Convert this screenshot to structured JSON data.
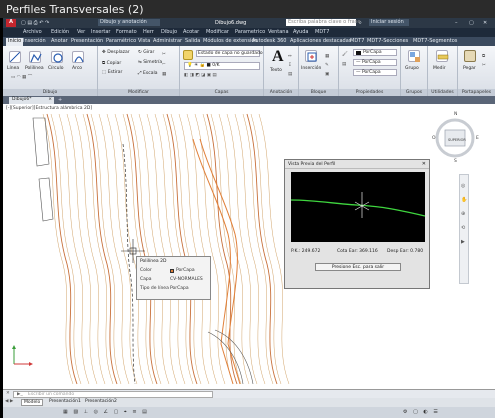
{
  "window": {
    "title": "Perfiles Transversales (2)"
  },
  "qat": {
    "workspace": "Dibujo y anotación",
    "filename": "Dibujo6.dwg",
    "search_placeholder": "Escriba palabra clave o frase",
    "signin": "Iniciar sesión"
  },
  "menubar": {
    "items": [
      "Archivo",
      "Edición",
      "Ver",
      "Insertar",
      "Formato",
      "Herr",
      "Dibujo",
      "Acotar",
      "Modificar",
      "Parametrico",
      "Ventana",
      "Ayuda",
      "MDT7"
    ]
  },
  "ribbon_tabs": {
    "items": [
      "Inicio",
      "Inserción",
      "Anotar",
      "Presentación",
      "Paramétrico",
      "Vista",
      "Administrar",
      "Salida",
      "Módulos de extensión",
      "Autodesk 360",
      "Aplicaciones destacadas",
      "MDT7",
      "MDT7-Secciones",
      "MDT7-Segmentos"
    ],
    "active_index": 0
  },
  "ribbon": {
    "draw": {
      "title": "Dibujo",
      "buttons": [
        "Línea",
        "Polilínea",
        "Círculo",
        "Arco"
      ]
    },
    "modify": {
      "title": "Modificar",
      "buttons": [
        "Desplazar",
        "Girar",
        "Copiar",
        "Simetría",
        "Estirar",
        "Escala"
      ]
    },
    "layers": {
      "title": "Capas",
      "state_label": "Estado de capa no guardado",
      "layer_name": "0/K"
    },
    "annotation": {
      "title": "Anotación",
      "text_label": "Texto"
    },
    "block": {
      "title": "Bloque",
      "insert_label": "Inserción"
    },
    "properties": {
      "title": "Propiedades",
      "color_value": "PorCapa",
      "linetype_value": "PorCapa",
      "lineweight_value": "PorCapa"
    },
    "groups": {
      "title": "Grupos",
      "group_label": "Grupo"
    },
    "utilities": {
      "title": "Utilidades",
      "measure_label": "Medir"
    },
    "clipboard": {
      "title": "Portapapeles",
      "paste_label": "Pegar"
    }
  },
  "document_tab": {
    "label": "Dibujo6*"
  },
  "viewport": {
    "label": "[-][Superior][Estructura alámbrica 2D]"
  },
  "viewcube": {
    "face_label": "SUPERIOR",
    "north": "N",
    "south": "S",
    "east": "E",
    "west": "O"
  },
  "tooltip": {
    "title": "Polilínea 2D",
    "rows": [
      {
        "label": "Color",
        "value": "PorCapa"
      },
      {
        "label": "Capa",
        "value": "CV-NORMALES"
      },
      {
        "label": "Tipo de línea",
        "value": "PorCapa"
      }
    ]
  },
  "profile_window": {
    "title": "Vista Previa del Perfil",
    "pk": "P.K.: 249.672",
    "cota": "Cota Ear: 369.116",
    "desp": "Desp Ear: 0.780",
    "esc_button": "Presione Esc. para salir"
  },
  "command": {
    "placeholder": "Escribir un comando"
  },
  "layout_tabs": [
    "Modelo",
    "Presentación1",
    "Presentación2"
  ],
  "status": {
    "coordinates": ""
  },
  "colors": {
    "profile_line": "#3fd63f",
    "contour": "#d2a46a",
    "contour_index": "#c8703a",
    "road": "#e0803a"
  }
}
